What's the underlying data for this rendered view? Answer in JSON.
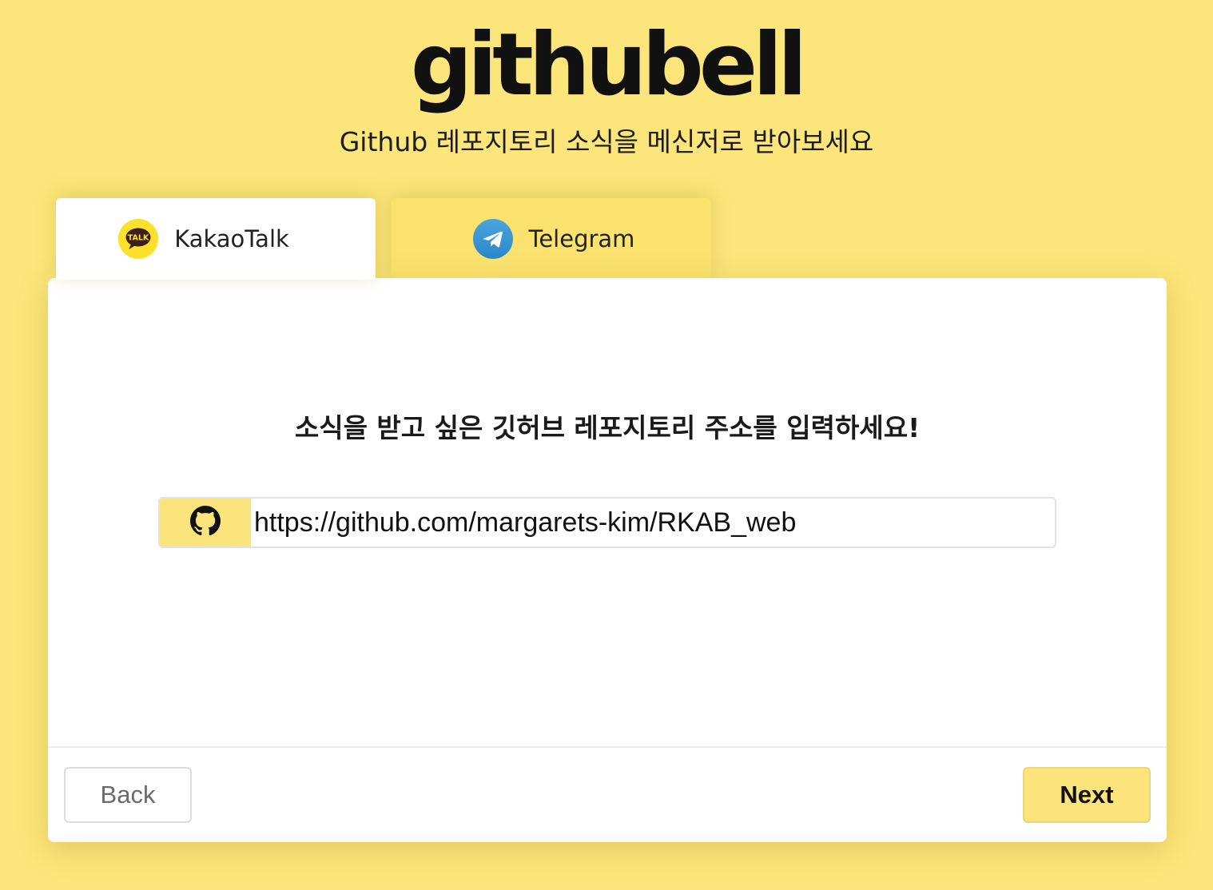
{
  "header": {
    "logo": "githubell",
    "subtitle": "Github 레포지토리 소식을 메신저로 받아보세요"
  },
  "tabs": [
    {
      "label": "KakaoTalk",
      "icon": "kakaotalk-icon",
      "icon_text": "TALK",
      "selected": true
    },
    {
      "label": "Telegram",
      "icon": "telegram-icon",
      "selected": false
    }
  ],
  "main": {
    "prompt": "소식을 받고 싶은 깃허브 레포지토리 주소를 입력하세요!",
    "repo_input": {
      "icon": "github-icon",
      "value": "https://github.com/margarets-kim/RKAB_web",
      "placeholder": ""
    }
  },
  "footer": {
    "back_label": "Back",
    "next_label": "Next"
  },
  "colors": {
    "background": "#fce57a",
    "accent": "#fce47a",
    "kakao": "#fce02a",
    "telegram": "#2b9fd9"
  }
}
